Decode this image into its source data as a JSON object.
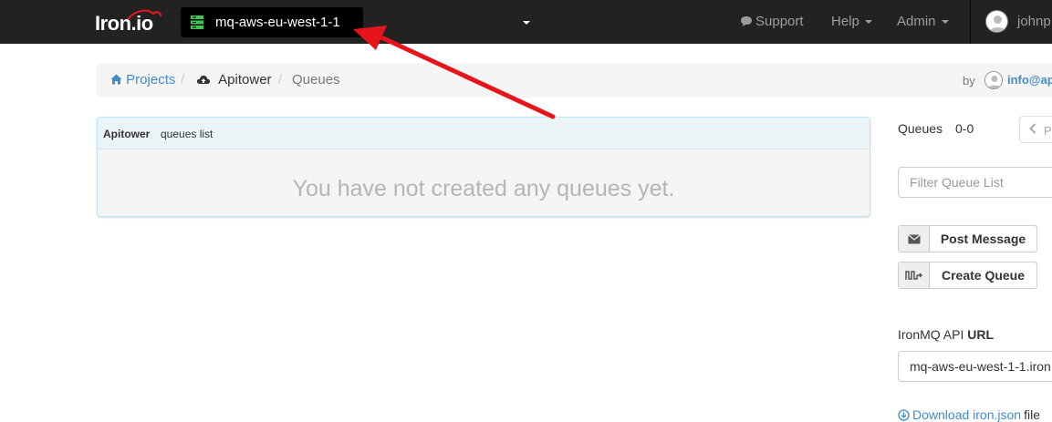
{
  "navbar": {
    "brand": "Iron.io",
    "cluster": "mq-aws-eu-west-1-1",
    "links": {
      "support": "Support",
      "help": "Help",
      "admin": "Admin"
    },
    "user": "johnp"
  },
  "breadcrumb": {
    "projects": "Projects",
    "project": "Apitower",
    "current": "Queues",
    "sep": "/",
    "by_label": "by",
    "by_user": "info@ap"
  },
  "panel": {
    "project": "Apitower",
    "subtitle": "queues list",
    "empty_message": "You have not created any queues yet."
  },
  "sidebar": {
    "title": "Queues",
    "count": "0-0",
    "pager_label": "P",
    "filter_placeholder": "Filter Queue List",
    "post_message": "Post Message",
    "create_queue": "Create Queue",
    "api_label_prefix": "IronMQ API",
    "api_label_bold": "URL",
    "api_url": "mq-aws-eu-west-1-1.iron",
    "download_link": "Download iron.json",
    "download_suffix": "file"
  },
  "colors": {
    "navbar_bg": "#222222",
    "link": "#428bca",
    "annotation_arrow": "#e8141c",
    "cluster_icon": "#3ec74b"
  }
}
